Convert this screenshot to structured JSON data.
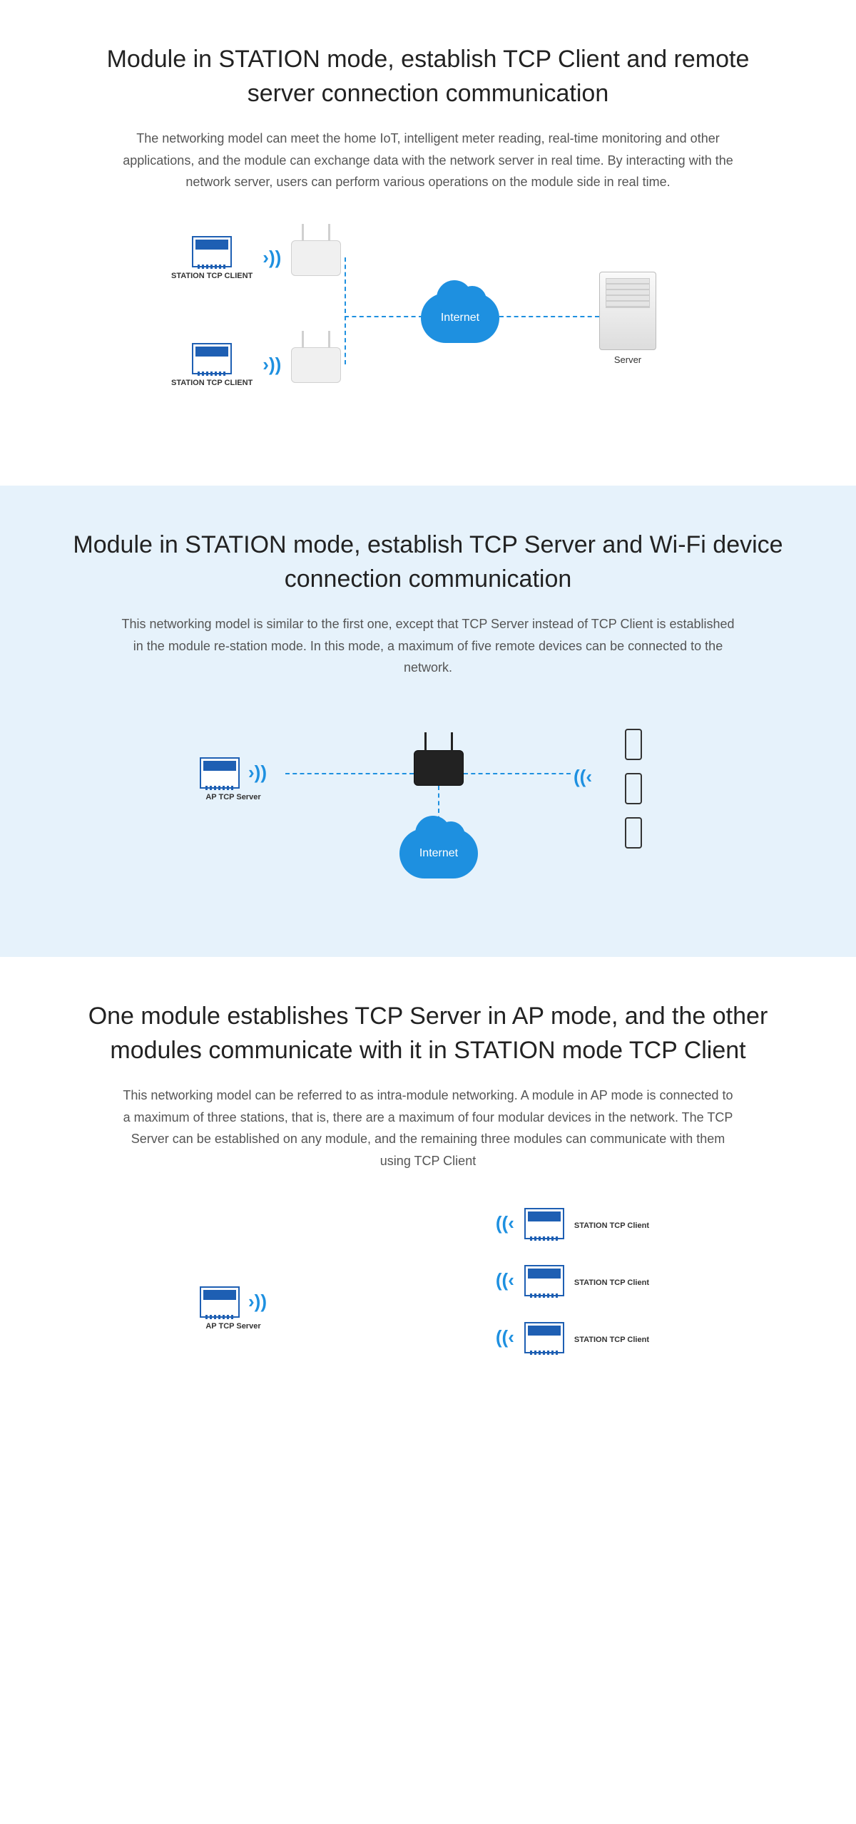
{
  "section1": {
    "title": "Module in STATION mode, establish TCP Client and remote server connection communication",
    "desc": "The networking model can meet the home IoT, intelligent meter reading, real-time monitoring and other applications, and the module can exchange data with the network server in real time. By interacting with the network server, users can perform various operations on the module side in real time.",
    "label_client": "STATION TCP CLIENT",
    "label_internet": "Internet",
    "label_server": "Server"
  },
  "section2": {
    "title": "Module in STATION mode, establish TCP Server and Wi-Fi device connection communication",
    "desc": "This networking model is similar to the first one, except that TCP Server instead of TCP Client is established in the module re-station mode. In this mode, a maximum of five remote devices can be connected to the network.",
    "label_ap": "AP TCP Server",
    "label_internet": "Internet"
  },
  "section3": {
    "title": "One module establishes TCP Server in AP mode, and the other modules communicate with it in STATION mode TCP Client",
    "desc": "This networking model can be referred to as intra-module networking. A module in AP mode is connected to a maximum of three stations, that is, there are a maximum of four modular devices in the network. The TCP Server can be established on any module, and the remaining three modules can communicate with them using TCP Client",
    "label_ap": "AP TCP Server",
    "label_client": "STATION TCP Client"
  }
}
